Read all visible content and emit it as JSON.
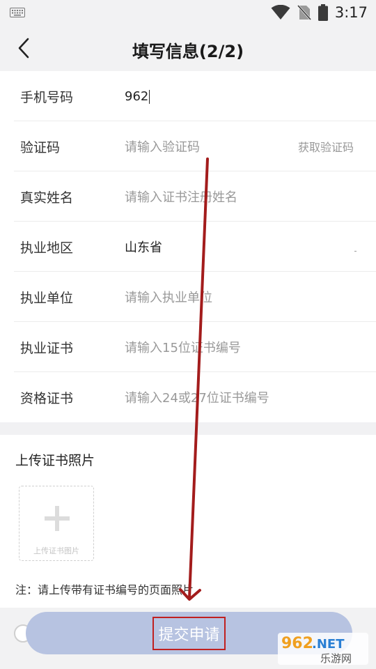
{
  "status_bar": {
    "time": "3:17",
    "icons": [
      "keyboard-icon",
      "wifi-icon",
      "no-sim-icon",
      "battery-icon"
    ]
  },
  "header": {
    "back_icon": "chevron-left-icon",
    "title": "填写信息(2/2)"
  },
  "form": {
    "rows": [
      {
        "label": "手机号码",
        "value": "962",
        "placeholder": ""
      },
      {
        "label": "验证码",
        "value": "",
        "placeholder": "请输入验证码",
        "action": "获取验证码"
      },
      {
        "label": "真实姓名",
        "value": "",
        "placeholder": "请输入证书注册姓名"
      },
      {
        "label": "执业地区",
        "value": "山东省",
        "placeholder": ""
      },
      {
        "label": "执业单位",
        "value": "",
        "placeholder": "请输入执业单位"
      },
      {
        "label": "执业证书",
        "value": "",
        "placeholder": "请输入15位证书编号"
      },
      {
        "label": "资格证书",
        "value": "",
        "placeholder": "请输入24或27位证书编号"
      }
    ]
  },
  "upload": {
    "title": "上传证书照片",
    "box_label": "上传证书图片",
    "note": "注：请上传带有证书编号的页面照片"
  },
  "bottom": {
    "submit_label": "提交申请"
  },
  "watermark": {
    "brand_top": "962.NET",
    "brand_bottom": "乐游网"
  },
  "colors": {
    "submit_bg": "#b7c3e1",
    "annotation": "#a31c1c",
    "page_bg": "#f1f1f3"
  }
}
